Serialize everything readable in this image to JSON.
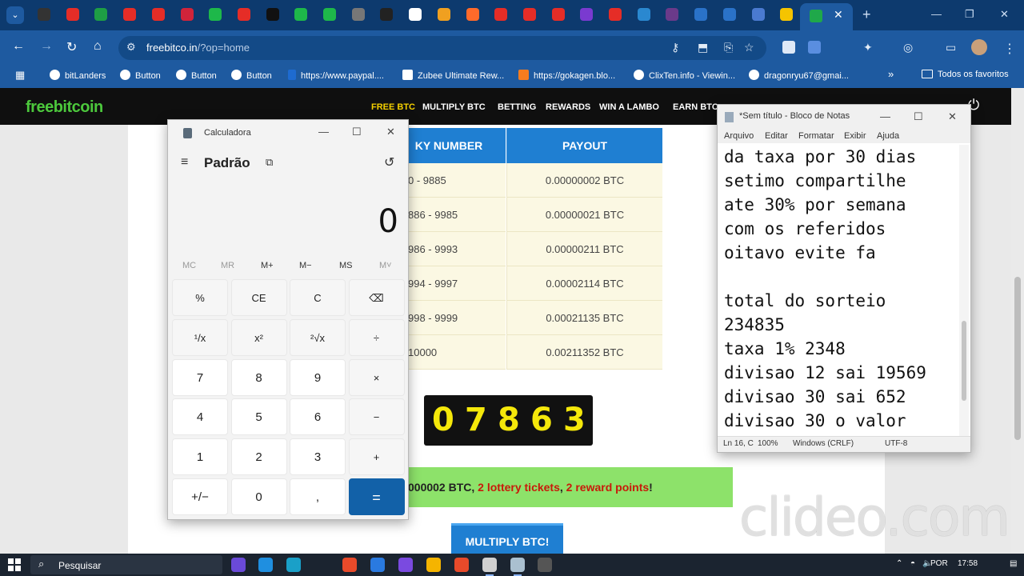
{
  "browser": {
    "url_host": "freebitco.in",
    "url_path": "/?op=home",
    "tab_colors": [
      "#333333",
      "#e52d27",
      "#1e9e45",
      "#e52d27",
      "#e52d27",
      "#d0243a",
      "#1eb84a",
      "#e52d27",
      "#111111",
      "#1eb84a",
      "#1eb84a",
      "#777777",
      "#222222",
      "#ffffff",
      "#f0a020",
      "#ff6a2a",
      "#e52d27",
      "#e52d27",
      "#e52d27",
      "#7a3ad0",
      "#e52d27",
      "#2a88d0",
      "#6a3a8a",
      "#2a72c8",
      "#2a72c8",
      "#4a7ad0",
      "#f5c400"
    ],
    "bookmarks": [
      "bitLanders",
      "Button",
      "Button",
      "Button",
      "https://www.paypal....",
      "Zubee Ultimate Rew...",
      "https://gokagen.blo...",
      "ClixTen.info - Viewin...",
      "dragonryu67@gmai...",
      "»",
      "Todos os favoritos"
    ]
  },
  "site": {
    "logo": "freebitcoin",
    "nav": [
      "FREE BTC",
      "MULTIPLY BTC",
      "BETTING",
      "REWARDS",
      "WIN A LAMBO",
      "EARN BTC"
    ],
    "table": {
      "headers": [
        "KY NUMBER",
        "PAYOUT"
      ],
      "rows": [
        [
          "0 - 9885",
          "0.00000002 BTC"
        ],
        [
          "886 - 9985",
          "0.00000021 BTC"
        ],
        [
          "986 - 9993",
          "0.00000211 BTC"
        ],
        [
          "994 - 9997",
          "0.00002114 BTC"
        ],
        [
          "998 - 9999",
          "0.00021135 BTC"
        ],
        [
          "10000",
          "0.00211352 BTC"
        ]
      ]
    },
    "rolled_number": [
      "0",
      "7",
      "8",
      "6",
      "3"
    ],
    "win_message": {
      "part1": "000002 BTC, ",
      "part2": "2 lottery tickets",
      "part3": ", ",
      "part4": "2 reward points",
      "part5": "!"
    },
    "multiply_button": "MULTIPLY BTC!"
  },
  "calculator": {
    "title": "Calculadora",
    "mode": "Padrão",
    "display": "0",
    "memory": [
      "MC",
      "MR",
      "M+",
      "M−",
      "MS",
      "M˅"
    ],
    "keys": [
      "%",
      "CE",
      "C",
      "⌫",
      "¹/x",
      "x²",
      "²√x",
      "÷",
      "7",
      "8",
      "9",
      "×",
      "4",
      "5",
      "6",
      "−",
      "1",
      "2",
      "3",
      "+",
      "+/−",
      "0",
      ",",
      "="
    ]
  },
  "notepad": {
    "title": "*Sem título - Bloco de Notas",
    "menu": [
      "Arquivo",
      "Editar",
      "Formatar",
      "Exibir",
      "Ajuda"
    ],
    "lines": [
      "da taxa por 30 dias",
      "setimo compartilhe",
      "ate 30% por semana",
      "com os referidos",
      "oitavo evite fa",
      "",
      "total do sorteio",
      "234835",
      "taxa 1% 2348",
      "divisao 12 sai 19569",
      "divisao 30 sai 652",
      "divisao 30 o valor"
    ],
    "status": {
      "position": "Ln 16, C",
      "zoom": "100%",
      "line_ending": "Windows (CRLF)",
      "encoding": "UTF-8"
    }
  },
  "watermark": "clideo.com",
  "taskbar": {
    "search": "Pesquisar",
    "language": "POR",
    "time": "17:58",
    "app_colors": [
      "#6a4ad8",
      "#1f8fe0",
      "#1aa0c8",
      "#e84a2a",
      "#2a7ae0",
      "#7a4ae0",
      "#f5b400",
      "#e84a2a",
      "#d0d0d0",
      "#aac0d0",
      "#555555"
    ]
  }
}
